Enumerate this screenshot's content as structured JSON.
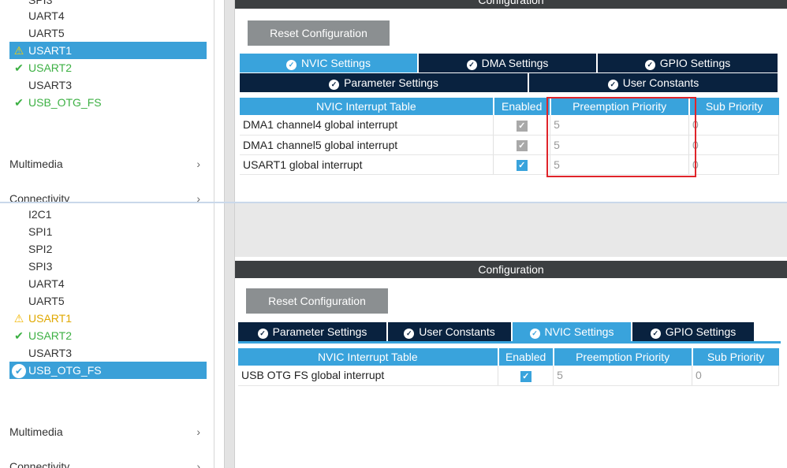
{
  "top": {
    "sidebar": {
      "partial_item": "SPI3",
      "items": [
        {
          "label": "UART4",
          "status": "none"
        },
        {
          "label": "UART5",
          "status": "none"
        },
        {
          "label": "USART1",
          "status": "warning"
        },
        {
          "label": "USART2",
          "status": "enabled"
        },
        {
          "label": "USART3",
          "status": "none"
        },
        {
          "label": "USB_OTG_FS",
          "status": "enabled"
        }
      ],
      "selected": "USART1",
      "sections": [
        "Multimedia",
        "Connectivity"
      ]
    },
    "config_title": "Configuration",
    "reset_label": "Reset Configuration",
    "tabs_row1": [
      "NVIC Settings",
      "DMA Settings",
      "GPIO Settings"
    ],
    "tabs_row2": [
      "Parameter Settings",
      "User Constants"
    ],
    "active_tab": "NVIC Settings",
    "table": {
      "headers": [
        "NVIC Interrupt Table",
        "Enabled",
        "Preemption Priority",
        "Sub Priority"
      ],
      "rows": [
        {
          "name": "DMA1 channel4 global interrupt",
          "enabled": true,
          "editable": false,
          "preemption": "5",
          "sub": "0"
        },
        {
          "name": "DMA1 channel5 global interrupt",
          "enabled": true,
          "editable": false,
          "preemption": "5",
          "sub": "0"
        },
        {
          "name": "USART1 global interrupt",
          "enabled": true,
          "editable": true,
          "preemption": "5",
          "sub": "0"
        }
      ]
    }
  },
  "bottom": {
    "sidebar": {
      "items": [
        {
          "label": "I2C1",
          "status": "none"
        },
        {
          "label": "SPI1",
          "status": "none"
        },
        {
          "label": "SPI2",
          "status": "none"
        },
        {
          "label": "SPI3",
          "status": "none"
        },
        {
          "label": "UART4",
          "status": "none"
        },
        {
          "label": "UART5",
          "status": "none"
        },
        {
          "label": "USART1",
          "status": "warning"
        },
        {
          "label": "USART2",
          "status": "enabled"
        },
        {
          "label": "USART3",
          "status": "none"
        },
        {
          "label": "USB_OTG_FS",
          "status": "enabled"
        }
      ],
      "selected": "USB_OTG_FS",
      "sections": [
        "Multimedia",
        "Connectivity"
      ]
    },
    "config_title": "Configuration",
    "reset_label": "Reset Configuration",
    "tabs": [
      "Parameter Settings",
      "User Constants",
      "NVIC Settings",
      "GPIO Settings"
    ],
    "active_tab": "NVIC Settings",
    "table": {
      "headers": [
        "NVIC Interrupt Table",
        "Enabled",
        "Preemption Priority",
        "Sub Priority"
      ],
      "rows": [
        {
          "name": "USB OTG FS global interrupt",
          "enabled": true,
          "editable": true,
          "preemption": "5",
          "sub": "0"
        }
      ]
    }
  },
  "colors": {
    "accent": "#39a3dc",
    "tab_dark": "#09223f",
    "config_bar": "#3c3f41",
    "enabled_green": "#3cb043",
    "warning_yellow": "#f2b600",
    "highlight_red": "#e0242a"
  },
  "icons": {
    "warning": "warning-triangle-icon",
    "enabled": "checkmark-icon",
    "selected_enabled": "circle-check-icon",
    "chevron": "chevron-right-icon"
  }
}
